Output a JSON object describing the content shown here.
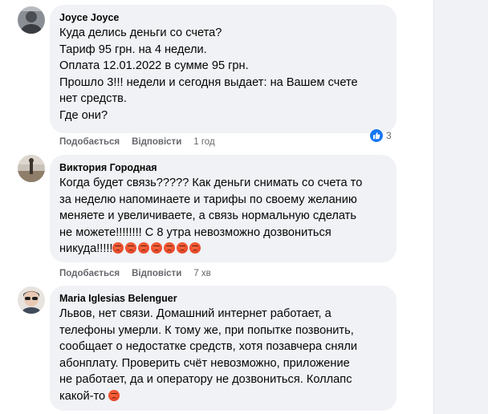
{
  "comments": [
    {
      "author": "Joyce Joyce",
      "text": "Куда делись деньги со счета?\nТариф 95 грн. на 4 недели.\nОплата 12.01.2022 в сумме 95 грн.\nПрошло 3!!! недели и сегодня выдает: на Вашем счете\nнет средств.\nГде они?",
      "like_label": "Подобається",
      "reply_label": "Відповісти",
      "time": "1 год",
      "reaction_count": "3",
      "reaction_icon": "like-icon"
    },
    {
      "author": "Виктория Городная",
      "text": "Когда будет связь????? Как деньги снимать со счета то\nза неделю напоминаете и тарифы по своему желанию\nменяете и увеличиваете, а связь нормальную сделать\nне можете!!!!!!!! С 8 утра невозможно дозвониться\nникуда!!!!!",
      "trailing_emoji": "angry-face-icon",
      "trailing_emoji_count": 7,
      "like_label": "Подобається",
      "reply_label": "Відповісти",
      "time": "7 хв"
    },
    {
      "author": "Maria Iglesias Belenguer",
      "text": "Львов, нет связи. Домашний интернет работает, а\nтелефоны умерли. К тому же, при попытке позвонить,\nсообщает о недостатке средств, хотя позавчера сняли\nабонплату. Проверить счёт невозможно, приложение\nне работает, да и оператору не дозвониться. Коллапс\nкакой-то",
      "trailing_emoji": "angry-face-icon",
      "trailing_emoji_count": 1
    }
  ],
  "colors": {
    "bubble": "#f0f2f5",
    "meta_text": "#65676b",
    "like_blue": "#1877f2"
  }
}
